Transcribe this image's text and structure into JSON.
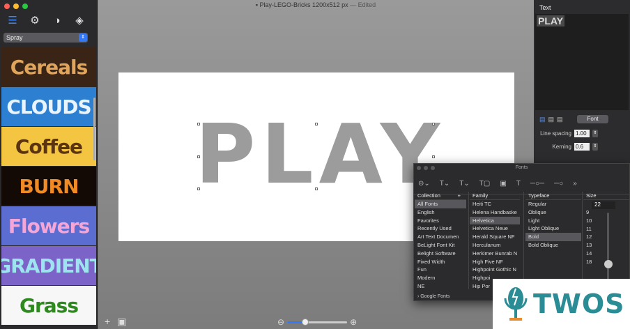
{
  "window": {
    "title": "Play-LEGO-Bricks 1200x512 px",
    "status": "Edited",
    "traffic_colors": [
      "#ff5f57",
      "#febc2e",
      "#28c840"
    ]
  },
  "left_panel": {
    "toolbar_icons": [
      "list-icon",
      "gear-icon",
      "shapes-icon",
      "layers-icon"
    ],
    "preset_select": "Spray",
    "styles": [
      {
        "label": "Cereals",
        "bg": "#3a2416",
        "color": "#e0a55a"
      },
      {
        "label": "CLOUDS",
        "bg": "#2d7fd1",
        "color": "#e8f4ff"
      },
      {
        "label": "Coffee",
        "bg": "#f4c541",
        "color": "#5a3313"
      },
      {
        "label": "BURN",
        "bg": "#140a05",
        "color": "#f08a24"
      },
      {
        "label": "Flowers",
        "bg": "#5b6dd1",
        "color": "#f6a6d6"
      },
      {
        "label": "GRADIENT",
        "bg": "#7c63c8",
        "color": "#9ee4f0"
      },
      {
        "label": "Grass",
        "bg": "#f7f7f7",
        "color": "#2e8a1e"
      }
    ]
  },
  "canvas": {
    "text": "PLAY",
    "zoom_fraction": 0.3
  },
  "right_panel": {
    "section_title": "Text",
    "text_content": "PLAY",
    "font_button": "Font",
    "line_spacing_label": "Line spacing",
    "line_spacing_value": "1.00",
    "kerning_label": "Kerning",
    "kerning_value": "0.6"
  },
  "fonts_panel": {
    "title": "Fonts",
    "collection_header": "Collection",
    "family_header": "Family",
    "typeface_header": "Typeface",
    "size_header": "Size",
    "collections": [
      "All Fonts",
      "English",
      "Favorites",
      "Recently Used",
      "Art Text Documen",
      "BeLight Font Kit",
      "Belight Software",
      "Fixed Width",
      "Fun",
      "Modern",
      "NE"
    ],
    "collection_selected": 0,
    "families": [
      "Heiti TC",
      "Helena Handbaske",
      "Helvetica",
      "Helvetica Neue",
      "Herald Square NF",
      "Herculanum",
      "Herkimer Bunrab N",
      "High Five NF",
      "Highpoint Gothic N",
      "Highpoi",
      "Hip Por"
    ],
    "family_selected": 2,
    "typefaces": [
      "Regular",
      "Oblique",
      "Light",
      "Light Oblique",
      "Bold",
      "Bold Oblique"
    ],
    "typeface_selected": 4,
    "size_value": "22",
    "sizes": [
      "9",
      "10",
      "11",
      "12",
      "13",
      "14",
      "18"
    ],
    "google_fonts": "Google Fonts"
  },
  "watermark": {
    "text": "TWOS"
  }
}
